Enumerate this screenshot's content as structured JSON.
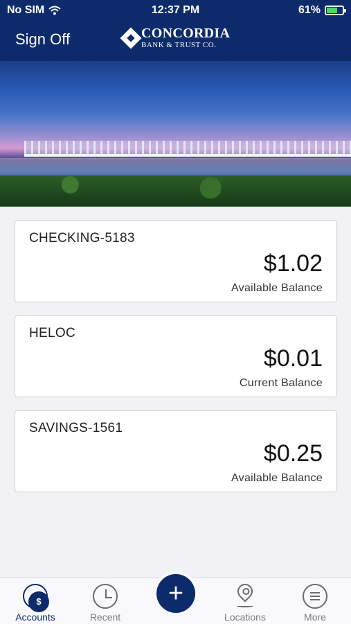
{
  "status_bar": {
    "carrier": "No SIM",
    "time": "12:37 PM",
    "battery_percent": "61%",
    "battery_level": 0.61
  },
  "header": {
    "sign_off_label": "Sign Off",
    "logo_main": "CONCORDIA",
    "logo_sub": "BANK & TRUST CO."
  },
  "accounts": [
    {
      "name": "CHECKING-5183",
      "balance": "$1.02",
      "balance_label": "Available Balance"
    },
    {
      "name": "HELOC",
      "balance": "$0.01",
      "balance_label": "Current Balance"
    },
    {
      "name": "SAVINGS-1561",
      "balance": "$0.25",
      "balance_label": "Available Balance"
    }
  ],
  "tab_bar": {
    "accounts_label": "Accounts",
    "accounts_icon_text": "$",
    "recent_label": "Recent",
    "add_symbol": "+",
    "locations_label": "Locations",
    "more_label": "More"
  },
  "colors": {
    "brand": "#0d2a6b",
    "battery": "#4cd964"
  }
}
